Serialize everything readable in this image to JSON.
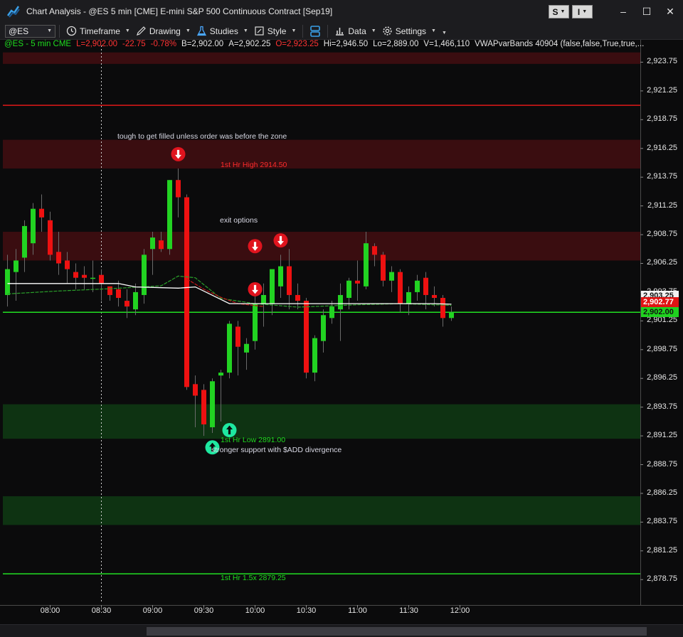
{
  "window": {
    "title": "Chart Analysis - @ES 5 min [CME] E-mini S&P 500 Continuous Contract [Sep19]",
    "btn_s": "S",
    "btn_i": "I",
    "minimize": "–",
    "maximize": "☐",
    "close": "✕"
  },
  "toolbar": {
    "symbol": "@ES",
    "timeframe": "Timeframe",
    "drawing": "Drawing",
    "studies": "Studies",
    "style": "Style",
    "data": "Data",
    "settings": "Settings"
  },
  "legend": {
    "symbol": "@ES - 5 min  CME",
    "last": "L=2,902.00",
    "change": "-22.75",
    "change_pct": "-0.78%",
    "bid": "B=2,902.00",
    "ask": "A=2,902.25",
    "open": "O=2,923.25",
    "high": "Hi=2,946.50",
    "low": "Lo=2,889.00",
    "volume": "V=1,466,110",
    "study": "VWAPvarBands 40904 (false,false,True,true,..."
  },
  "annotations": {
    "note_top": "tough to get filled unless order was before the zone",
    "hr_high": "1st Hr High 2914.50",
    "exit_options": "exit options",
    "hr_low": "1st Hr Low 2891.00",
    "support_note": "stronger support with $ADD divergence",
    "hr_15x": "1st Hr 1.5x 2879.25"
  },
  "price_axis": {
    "labels": [
      "2,923.75",
      "2,921.25",
      "2,918.75",
      "2,916.25",
      "2,913.75",
      "2,911.25",
      "2,908.75",
      "2,906.25",
      "2,903.75",
      "2,901.25",
      "2,898.75",
      "2,896.25",
      "2,893.75",
      "2,891.25",
      "2,888.75",
      "2,886.25",
      "2,883.75",
      "2,881.25",
      "2,878.75"
    ],
    "tag_white": "2,903.25",
    "tag_red": "2,902.77",
    "tag_green": "2,902.00"
  },
  "time_axis": {
    "labels": [
      "08:00",
      "08:30",
      "09:00",
      "09:30",
      "10:00",
      "10:30",
      "11:00",
      "11:30",
      "12:00"
    ]
  },
  "colors": {
    "up": "#22d322",
    "down": "#ee1111",
    "background": "#0b0b0c",
    "zone_red": "#3a0d10",
    "zone_green": "#0e3312",
    "line_red": "#e01818",
    "line_green": "#22e022",
    "vwap": "#ffffff",
    "arrow_down": "#e0141e",
    "arrow_up": "#1ee8a0"
  },
  "chart_data": {
    "type": "candlestick",
    "ylim": [
      2876.85,
      2925.2
    ],
    "grid": false,
    "price_lines": [
      {
        "price": 2920.0,
        "color": "red"
      },
      {
        "price": 2902.0,
        "color": "green"
      },
      {
        "price": 2879.25,
        "color": "green"
      }
    ],
    "zones": [
      {
        "from": 2923.6,
        "to": 2924.6,
        "color": "red"
      },
      {
        "from": 2914.5,
        "to": 2917.0,
        "color": "red"
      },
      {
        "from": 2906.5,
        "to": 2909.0,
        "color": "red"
      },
      {
        "from": 2891.0,
        "to": 2894.0,
        "color": "green"
      },
      {
        "from": 2883.5,
        "to": 2886.0,
        "color": "green"
      }
    ],
    "x_axis_start": "07:35",
    "bar_minutes": 5,
    "candles": [
      {
        "o": 2903.5,
        "h": 2907.0,
        "l": 2902.5,
        "c": 2905.75
      },
      {
        "o": 2905.5,
        "h": 2907.5,
        "l": 2903.0,
        "c": 2906.5
      },
      {
        "o": 2906.75,
        "h": 2910.0,
        "l": 2905.5,
        "c": 2909.5
      },
      {
        "o": 2908.0,
        "h": 2911.5,
        "l": 2907.0,
        "c": 2911.0
      },
      {
        "o": 2911.0,
        "h": 2912.25,
        "l": 2909.0,
        "c": 2910.25
      },
      {
        "o": 2910.0,
        "h": 2910.75,
        "l": 2906.5,
        "c": 2907.0
      },
      {
        "o": 2907.25,
        "h": 2909.0,
        "l": 2905.25,
        "c": 2906.25
      },
      {
        "o": 2906.5,
        "h": 2907.25,
        "l": 2904.5,
        "c": 2905.75
      },
      {
        "o": 2905.5,
        "h": 2906.25,
        "l": 2904.0,
        "c": 2905.0
      },
      {
        "o": 2905.25,
        "h": 2906.0,
        "l": 2904.0,
        "c": 2905.0
      },
      {
        "o": 2905.0,
        "h": 2906.5,
        "l": 2903.75,
        "c": 2905.0
      },
      {
        "o": 2905.25,
        "h": 2905.75,
        "l": 2903.0,
        "c": 2904.5
      },
      {
        "o": 2904.25,
        "h": 2904.25,
        "l": 2903.0,
        "c": 2903.5
      },
      {
        "o": 2904.0,
        "h": 2904.75,
        "l": 2902.5,
        "c": 2903.25
      },
      {
        "o": 2903.0,
        "h": 2904.0,
        "l": 2901.5,
        "c": 2902.5
      },
      {
        "o": 2902.25,
        "h": 2904.5,
        "l": 2901.75,
        "c": 2903.75
      },
      {
        "o": 2903.5,
        "h": 2907.5,
        "l": 2902.75,
        "c": 2907.0
      },
      {
        "o": 2907.5,
        "h": 2909.0,
        "l": 2905.25,
        "c": 2908.5
      },
      {
        "o": 2908.25,
        "h": 2909.0,
        "l": 2907.25,
        "c": 2907.5
      },
      {
        "o": 2907.5,
        "h": 2913.5,
        "l": 2907.0,
        "c": 2913.5
      },
      {
        "o": 2913.5,
        "h": 2914.5,
        "l": 2910.25,
        "c": 2912.0
      },
      {
        "o": 2912.0,
        "h": 2912.25,
        "l": 2895.25,
        "c": 2895.5
      },
      {
        "o": 2895.75,
        "h": 2896.5,
        "l": 2892.0,
        "c": 2894.75
      },
      {
        "o": 2895.25,
        "h": 2895.75,
        "l": 2891.25,
        "c": 2892.25
      },
      {
        "o": 2892.0,
        "h": 2896.25,
        "l": 2891.5,
        "c": 2896.0
      },
      {
        "o": 2896.5,
        "h": 2897.0,
        "l": 2892.5,
        "c": 2896.75
      },
      {
        "o": 2896.75,
        "h": 2901.25,
        "l": 2896.25,
        "c": 2901.0
      },
      {
        "o": 2900.75,
        "h": 2901.25,
        "l": 2896.5,
        "c": 2899.0
      },
      {
        "o": 2898.5,
        "h": 2899.75,
        "l": 2897.0,
        "c": 2899.25
      },
      {
        "o": 2899.5,
        "h": 2903.5,
        "l": 2898.75,
        "c": 2902.75
      },
      {
        "o": 2902.75,
        "h": 2904.5,
        "l": 2900.75,
        "c": 2903.5
      },
      {
        "o": 2902.75,
        "h": 2905.0,
        "l": 2901.75,
        "c": 2905.75
      },
      {
        "o": 2904.25,
        "h": 2907.0,
        "l": 2903.25,
        "c": 2906.0
      },
      {
        "o": 2906.0,
        "h": 2907.5,
        "l": 2902.25,
        "c": 2903.5
      },
      {
        "o": 2903.5,
        "h": 2904.5,
        "l": 2902.25,
        "c": 2903.0
      },
      {
        "o": 2903.0,
        "h": 2903.25,
        "l": 2896.25,
        "c": 2896.75
      },
      {
        "o": 2896.75,
        "h": 2900.0,
        "l": 2896.0,
        "c": 2899.75
      },
      {
        "o": 2899.5,
        "h": 2902.25,
        "l": 2898.5,
        "c": 2901.75
      },
      {
        "o": 2901.5,
        "h": 2903.0,
        "l": 2901.0,
        "c": 2902.5
      },
      {
        "o": 2902.25,
        "h": 2904.5,
        "l": 2899.5,
        "c": 2903.5
      },
      {
        "o": 2903.25,
        "h": 2905.0,
        "l": 2902.25,
        "c": 2904.75
      },
      {
        "o": 2904.75,
        "h": 2906.5,
        "l": 2903.0,
        "c": 2904.5
      },
      {
        "o": 2904.25,
        "h": 2909.0,
        "l": 2904.0,
        "c": 2908.0
      },
      {
        "o": 2907.75,
        "h": 2908.0,
        "l": 2906.0,
        "c": 2907.0
      },
      {
        "o": 2907.0,
        "h": 2907.25,
        "l": 2904.25,
        "c": 2904.75
      },
      {
        "o": 2904.75,
        "h": 2906.0,
        "l": 2903.75,
        "c": 2905.5
      },
      {
        "o": 2905.5,
        "h": 2905.75,
        "l": 2902.0,
        "c": 2902.75
      },
      {
        "o": 2902.75,
        "h": 2904.25,
        "l": 2901.75,
        "c": 2903.75
      },
      {
        "o": 2903.75,
        "h": 2905.25,
        "l": 2903.0,
        "c": 2904.75
      },
      {
        "o": 2905.0,
        "h": 2905.5,
        "l": 2902.25,
        "c": 2903.5
      },
      {
        "o": 2903.5,
        "h": 2904.25,
        "l": 2902.5,
        "c": 2903.25
      },
      {
        "o": 2903.25,
        "h": 2903.5,
        "l": 2900.75,
        "c": 2901.5
      },
      {
        "o": 2901.5,
        "h": 2902.5,
        "l": 2901.25,
        "c": 2902.0
      }
    ],
    "vwap_white": [
      [
        0,
        2904.5
      ],
      [
        13,
        2904.5
      ],
      [
        15,
        2904.2
      ],
      [
        20,
        2904.1
      ],
      [
        22,
        2904.2
      ],
      [
        26,
        2902.75
      ],
      [
        50,
        2902.75
      ],
      [
        52,
        2902.7
      ]
    ],
    "vwap_green": [
      [
        0,
        2903.6
      ],
      [
        6,
        2903.85
      ],
      [
        12,
        2904.05
      ],
      [
        18,
        2904.3
      ],
      [
        20,
        2905.15
      ],
      [
        22,
        2905.0
      ],
      [
        25,
        2903.2
      ],
      [
        29,
        2902.75
      ],
      [
        34,
        2902.45
      ],
      [
        41,
        2902.65
      ],
      [
        46,
        2902.75
      ],
      [
        52,
        2902.6
      ]
    ],
    "vwap_red": [
      [
        21,
        2904.9
      ],
      [
        23,
        2904.0
      ],
      [
        25,
        2903.3
      ],
      [
        27,
        2902.75
      ],
      [
        30,
        2902.5
      ]
    ],
    "markers": [
      {
        "bar": 20,
        "price": 2915.75,
        "dir": "down"
      },
      {
        "bar": 29,
        "price": 2907.75,
        "dir": "down"
      },
      {
        "bar": 32,
        "price": 2908.25,
        "dir": "down"
      },
      {
        "bar": 29,
        "price": 2904.0,
        "dir": "down"
      },
      {
        "bar": 26,
        "price": 2891.75,
        "dir": "up"
      },
      {
        "bar": 24,
        "price": 2890.25,
        "dir": "up"
      }
    ]
  }
}
